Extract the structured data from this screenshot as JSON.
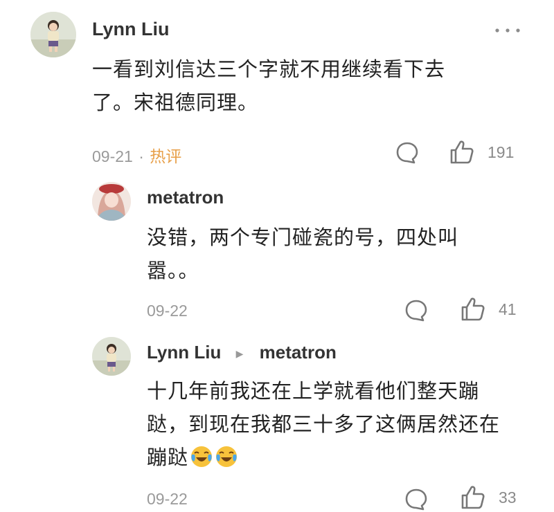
{
  "comments": [
    {
      "author": "Lynn Liu",
      "text_line1": "一看到刘信达三个字就不用继续看下去",
      "text_line2": "了。宋祖德同理。",
      "date": "09-21",
      "separator": "·",
      "tag": "热评",
      "likes": "191"
    }
  ],
  "replies": [
    {
      "author": "metatron",
      "text_line1": "没错，两个专门碰瓷的号，四处叫",
      "text_line2": "嚣。。",
      "date": "09-22",
      "likes": "41"
    },
    {
      "author": "Lynn Liu",
      "reply_to": "metatron",
      "text_line1": "十几年前我还在上学就看他们整天蹦",
      "text_line2": "跶，到现在我都三十多了这俩居然还在",
      "text_line3": "蹦跶",
      "emoji": [
        "crying-laughing-face",
        "crying-laughing-face"
      ],
      "date": "09-22",
      "likes": "33"
    }
  ],
  "icons": {
    "more": "more-options-icon",
    "reply": "comment-bubble-icon",
    "like": "thumbs-up-icon"
  },
  "colors": {
    "hot_tag": "#e8a04a",
    "meta_gray": "#9a9a9a"
  }
}
